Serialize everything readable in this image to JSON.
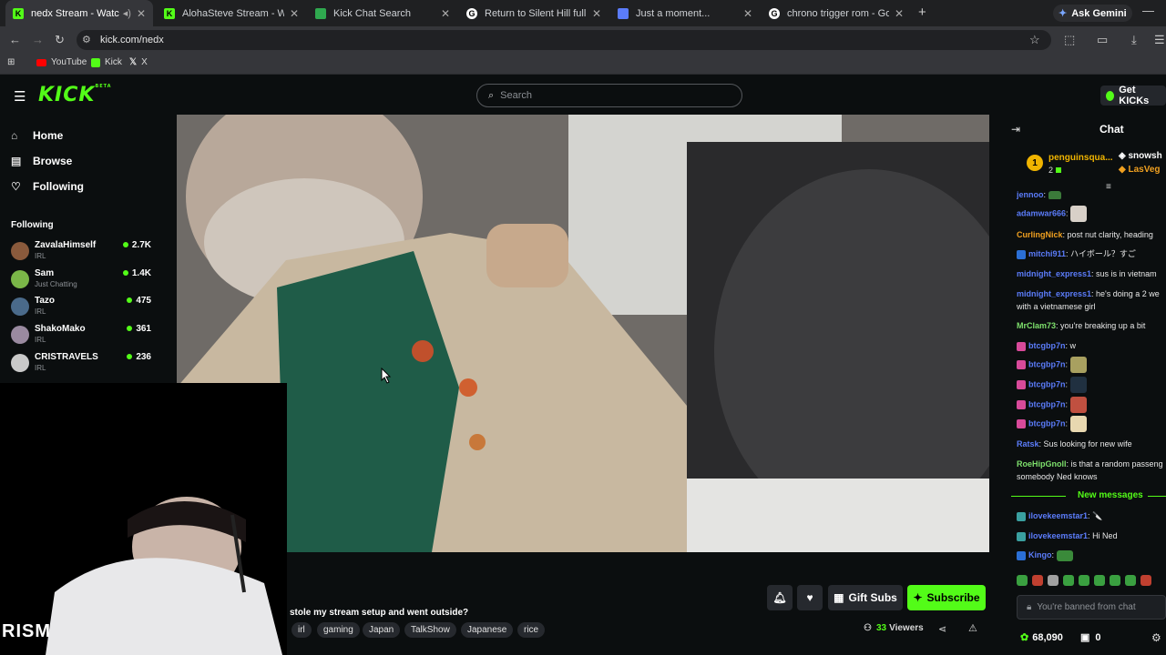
{
  "browser": {
    "tabs": [
      {
        "title": "nedx Stream - Watch Live o",
        "color": "#53fc18",
        "active": true
      },
      {
        "title": "AlohaSteve Stream - Watch Liv",
        "color": "#53fc18",
        "active": false
      },
      {
        "title": "Kick Chat Search",
        "color": "#2fa84f",
        "active": false
      },
      {
        "title": "Return to Silent Hill full movie",
        "color": "#ffffff",
        "active": false
      },
      {
        "title": "Just a moment...",
        "color": "#5b7cfa",
        "active": false
      },
      {
        "title": "chrono trigger rom - Google Se",
        "color": "#ffffff",
        "active": false
      }
    ],
    "new_tab": "+",
    "gemini": "Ask Gemini",
    "url": "kick.com/nedx",
    "bookmarks": [
      "YouTube",
      "Kick",
      "X"
    ]
  },
  "kick": {
    "logo": "KICK",
    "logo_beta": "BETA",
    "search_placeholder": "Search",
    "get_kicks": "Get KICKs"
  },
  "sidebar": {
    "nav": [
      {
        "label": "Home",
        "icon": "home-icon"
      },
      {
        "label": "Browse",
        "icon": "browse-icon"
      },
      {
        "label": "Following",
        "icon": "heart-icon"
      }
    ],
    "following_heading": "Following",
    "channels": [
      {
        "name": "ZavalaHimself",
        "category": "IRL",
        "viewers": "2.7K",
        "color": "#8a5a3c"
      },
      {
        "name": "Sam",
        "category": "Just Chatting",
        "viewers": "1.4K",
        "color": "#7ab648"
      },
      {
        "name": "Tazo",
        "category": "IRL",
        "viewers": "475",
        "color": "#4a6a8a"
      },
      {
        "name": "ShakoMako",
        "category": "IRL",
        "viewers": "361",
        "color": "#9a8aa0"
      },
      {
        "name": "CRISTRAVELS",
        "category": "IRL",
        "viewers": "236",
        "color": "#c9c9c9"
      }
    ]
  },
  "webcam": {
    "overlay": "RISM"
  },
  "stream": {
    "title": "stole my stream setup and went outside?",
    "tags": [
      "irl",
      "gaming",
      "Japan",
      "TalkShow",
      "Japanese",
      "rice"
    ],
    "viewers_count": "33",
    "viewers_label": "Viewers",
    "gift_subs": "Gift Subs",
    "subscribe": "Subscribe"
  },
  "chat": {
    "header": "Chat",
    "pinned": [
      {
        "name": "penguinsqua...",
        "count": "2",
        "rank": "1"
      },
      {
        "name": "snowsh",
        "sub": "LasVeg"
      }
    ],
    "messages": [
      {
        "user": "jennoo",
        "color": "#5b7cfa",
        "text": "",
        "emote": "#3b7a3a"
      },
      {
        "user": "adamwar666",
        "color": "#5b7cfa",
        "text": "",
        "emote": "#d8d0c8"
      },
      {
        "user": "CurlingNick",
        "color": "#f0a020",
        "text": "post nut clarity, heading"
      },
      {
        "user": "mitchi911",
        "color": "#5b7cfa",
        "text": "ハイボール？すご",
        "badge": "#2b6fd6"
      },
      {
        "user": "midnight_express1",
        "color": "#5b7cfa",
        "text": "sus is in vietnam"
      },
      {
        "user": "midnight_express1",
        "color": "#5b7cfa",
        "text": "he's doing a 2 we"
      },
      {
        "user": "",
        "color": "#e8e8e8",
        "text": "with a vietnamese girl"
      },
      {
        "user": "MrClam73",
        "color": "#7ee06c",
        "text": "you're breaking up a bit"
      },
      {
        "user": "btcgbp7n",
        "color": "#5b7cfa",
        "text": "w",
        "badge": "#d84a9a"
      },
      {
        "user": "btcgbp7n",
        "color": "#5b7cfa",
        "text": "",
        "badge": "#d84a9a",
        "emote": "#a8a060"
      },
      {
        "user": "btcgbp7n",
        "color": "#5b7cfa",
        "text": "",
        "badge": "#d84a9a",
        "emote": "#203040"
      },
      {
        "user": "btcgbp7n",
        "color": "#5b7cfa",
        "text": "",
        "badge": "#d84a9a",
        "emote": "#c05040"
      },
      {
        "user": "btcgbp7n",
        "color": "#5b7cfa",
        "text": "",
        "badge": "#d84a9a",
        "emote": "#e8d8b0"
      },
      {
        "user": "Ratsk",
        "color": "#5b7cfa",
        "text": "Sus looking for new wife"
      },
      {
        "user": "RoeHipGnoll",
        "color": "#7ee06c",
        "text": "is that a random passeng"
      },
      {
        "user": "",
        "color": "#e8e8e8",
        "text": "somebody Ned knows"
      }
    ],
    "new_messages": "New messages",
    "messages2": [
      {
        "user": "ilovekeemstar1",
        "color": "#5b7cfa",
        "text": "🔪",
        "badge": "#3aa0a0"
      },
      {
        "user": "ilovekeemstar1",
        "color": "#5b7cfa",
        "text": "Hi Ned",
        "badge": "#3aa0a0"
      },
      {
        "user": "Kingo",
        "color": "#5b7cfa",
        "text": "",
        "badge": "#2b6fd6",
        "emote": "#3a8a3a"
      }
    ],
    "banned": "You're banned from chat",
    "kicks_balance": "68,090",
    "gifts_count": "0"
  }
}
